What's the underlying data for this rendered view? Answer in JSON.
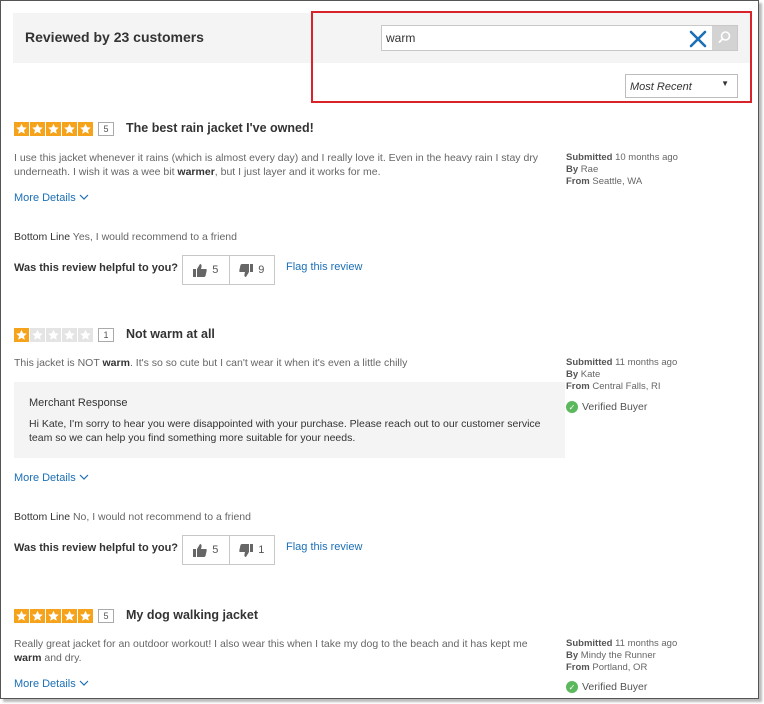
{
  "header": {
    "title": "Reviewed by 23 customers",
    "search_value": "warm",
    "sort_selected": "Most Recent"
  },
  "colors": {
    "star_on": "#f5a31a",
    "star_off": "#e4e4e4",
    "link": "#1b6fb6",
    "highlight": "#d8232a",
    "verified": "#5cb85c"
  },
  "reviews": [
    {
      "rating": 5,
      "rating_label": "5",
      "title": "The best rain jacket I've owned!",
      "body_before": "I use this jacket whenever it rains (which is almost every day) and I really love it. Even in the heavy rain I stay dry underneath. I wish it was a wee bit ",
      "body_highlight": "warmer",
      "body_after": ", but I just layer and it works for me.",
      "submitted_label": "Submitted",
      "submitted": "10 months ago",
      "by_label": "By",
      "author": "Rae",
      "from_label": "From",
      "location": "Seattle, WA",
      "more_details": "More Details",
      "bottom_line_label": "Bottom Line",
      "bottom_line": "Yes, I would recommend to a friend",
      "helpful_label": "Was this review helpful to you?",
      "helpful_yes": "5",
      "helpful_no": "9",
      "flag": "Flag this review"
    },
    {
      "rating": 1,
      "rating_label": "1",
      "title": "Not warm at all",
      "body_before": "This jacket is NOT ",
      "body_highlight": "warm",
      "body_after": ". It's so so cute but I can't wear it when it's even a little chilly",
      "submitted_label": "Submitted",
      "submitted": "11 months ago",
      "by_label": "By",
      "author": "Kate",
      "from_label": "From",
      "location": "Central Falls, RI",
      "verified": "Verified Buyer",
      "merchant_title": "Merchant Response",
      "merchant_text": "Hi Kate, I'm sorry to hear you were disappointed with your purchase. Please reach out to our customer service team so we can help you find something more suitable for your needs.",
      "more_details": "More Details",
      "bottom_line_label": "Bottom Line",
      "bottom_line": "No, I would not recommend to a friend",
      "helpful_label": "Was this review helpful to you?",
      "helpful_yes": "5",
      "helpful_no": "1",
      "flag": "Flag this review"
    },
    {
      "rating": 5,
      "rating_label": "5",
      "title": "My dog walking jacket",
      "body_before": "Really great jacket for an outdoor workout! I also wear this when I take my dog to the beach and it has kept me ",
      "body_highlight": "warm",
      "body_after": " and dry.",
      "submitted_label": "Submitted",
      "submitted": "11 months ago",
      "by_label": "By",
      "author": "Mindy the Runner",
      "from_label": "From",
      "location": "Portland, OR",
      "verified": "Verified Buyer",
      "more_details": "More Details"
    }
  ]
}
